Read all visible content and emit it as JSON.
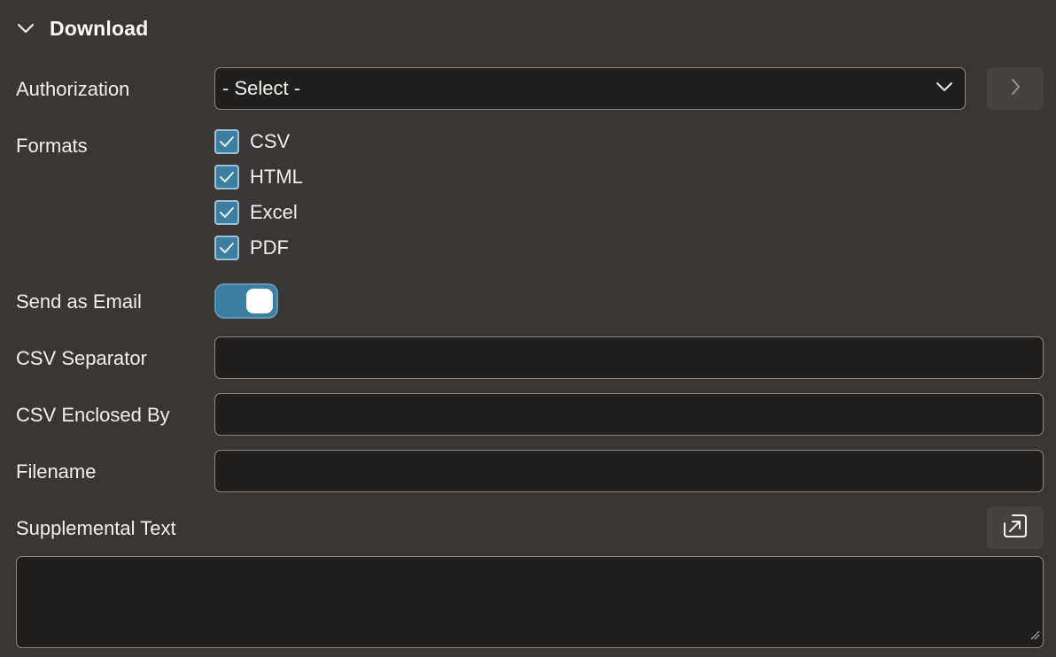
{
  "section": {
    "title": "Download",
    "expanded": true
  },
  "authorization": {
    "label": "Authorization",
    "selected": "- Select -"
  },
  "formats": {
    "label": "Formats",
    "options": [
      {
        "label": "CSV",
        "checked": true
      },
      {
        "label": "HTML",
        "checked": true
      },
      {
        "label": "Excel",
        "checked": true
      },
      {
        "label": "PDF",
        "checked": true
      }
    ]
  },
  "send_as_email": {
    "label": "Send as Email",
    "on": true
  },
  "csv_separator": {
    "label": "CSV Separator",
    "value": ""
  },
  "csv_enclosed_by": {
    "label": "CSV Enclosed By",
    "value": ""
  },
  "filename": {
    "label": "Filename",
    "value": ""
  },
  "supplemental_text": {
    "label": "Supplemental Text",
    "value": ""
  },
  "icons": {
    "collapse": "chevron-down-icon",
    "select_arrow": "chevron-down-icon",
    "navigate": "chevron-right-icon",
    "expand_editor": "expand-arrow-icon",
    "resize": "resize-grip-icon",
    "check": "checkmark-icon"
  },
  "colors": {
    "background": "#393633",
    "field_background": "#201f1e",
    "field_border": "#8b8784",
    "accent": "#3d7fa3",
    "button_background": "#45423f"
  }
}
